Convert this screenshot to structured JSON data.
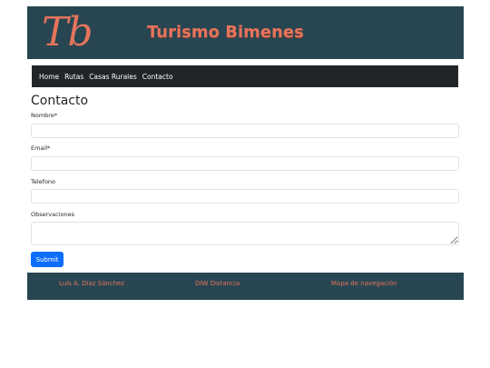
{
  "header": {
    "logo_text": "Tb",
    "site_title": "Turismo Bimenes"
  },
  "nav": {
    "items": [
      {
        "label": "Home"
      },
      {
        "label": "Rutas"
      },
      {
        "label": "Casas Rurales"
      },
      {
        "label": "Contacto"
      }
    ]
  },
  "form": {
    "title": "Contacto",
    "fields": [
      {
        "label": "Nombre*",
        "value": "",
        "placeholder": ""
      },
      {
        "label": "Email*",
        "value": "",
        "placeholder": ""
      },
      {
        "label": "Telefono",
        "value": "",
        "placeholder": ""
      },
      {
        "label": "Observaciones",
        "value": "",
        "placeholder": ""
      }
    ],
    "submit_label": "Submit"
  },
  "footer": {
    "links": [
      {
        "label": "Luis A. Díaz Sánchez"
      },
      {
        "label": "DIW Distancia"
      },
      {
        "label": "Mapa de navegación"
      }
    ]
  },
  "colors": {
    "header_bg": "#284651",
    "accent": "#e5745c",
    "navbar_bg": "#212529",
    "primary_button": "#0d6efd"
  }
}
